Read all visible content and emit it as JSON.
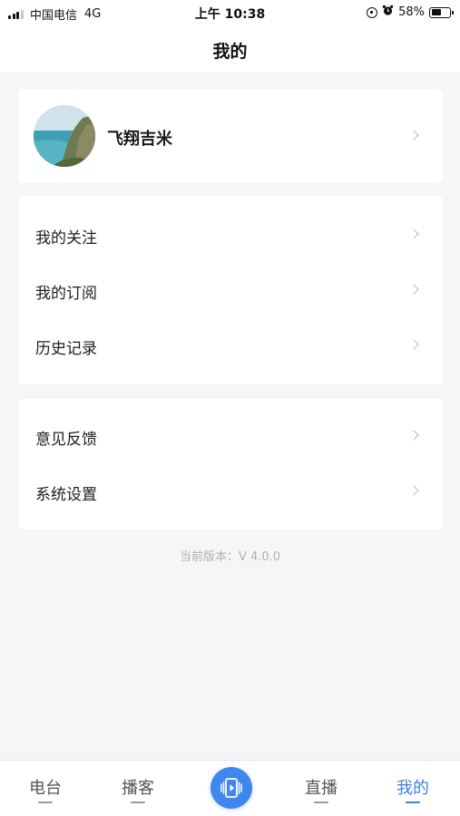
{
  "status_bar": {
    "carrier": "中国电信",
    "network": "4G",
    "time": "上午 10:38",
    "battery_percent": "58%",
    "battery_level": 0.58,
    "icons": [
      "signal-icon",
      "rotation-lock-icon",
      "alarm-icon",
      "battery-icon"
    ]
  },
  "header": {
    "title": "我的"
  },
  "profile": {
    "username": "飞翔吉米"
  },
  "menu_group1": [
    {
      "label": "我的关注"
    },
    {
      "label": "我的订阅"
    },
    {
      "label": "历史记录"
    }
  ],
  "menu_group2": [
    {
      "label": "意见反馈"
    },
    {
      "label": "系统设置"
    }
  ],
  "version": "当前版本：V 4.0.0",
  "tab_bar": {
    "tabs": [
      {
        "label": "电台"
      },
      {
        "label": "播客"
      },
      {
        "label": "直播"
      },
      {
        "label": "我的",
        "active": true
      }
    ],
    "center_icon": "video-play-icon",
    "accent_color": "#3a82f0"
  }
}
